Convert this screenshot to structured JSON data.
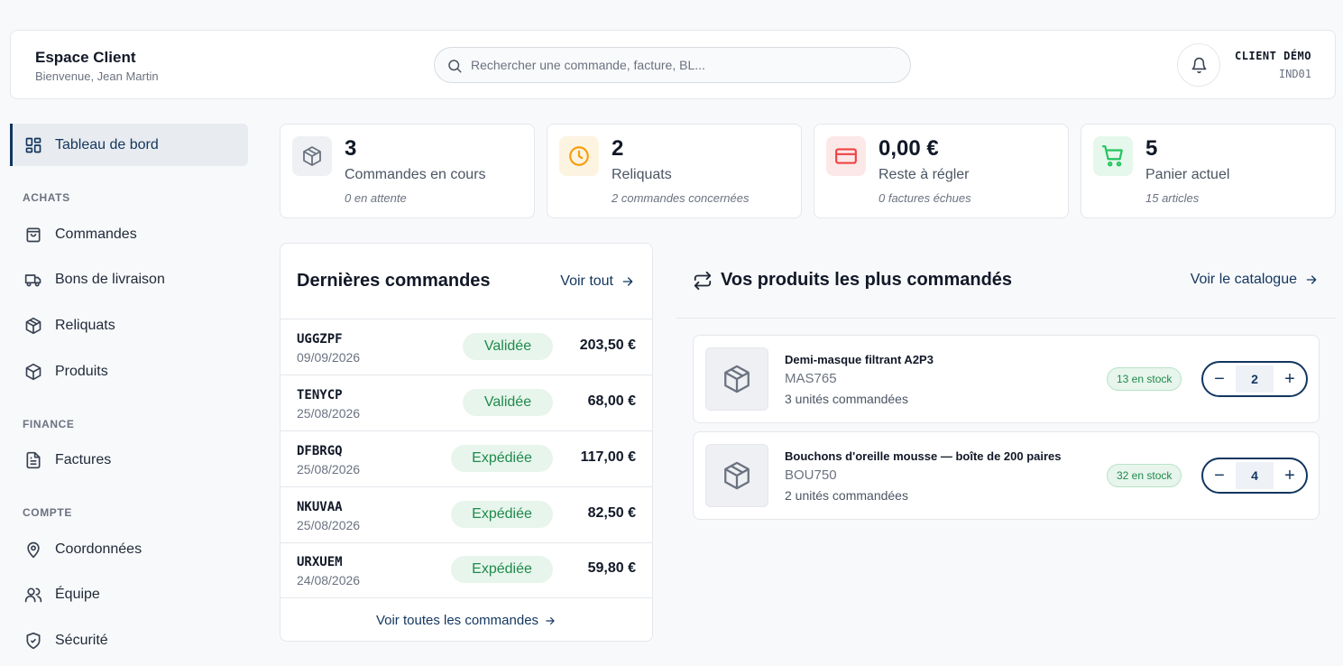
{
  "header": {
    "title": "Espace Client",
    "subtitle": "Bienvenue, Jean Martin",
    "search_placeholder": "Rechercher une commande, facture, BL...",
    "client_name": "CLIENT DÉMO",
    "client_code": "IND01"
  },
  "sidebar": {
    "dashboard": "Tableau de bord",
    "sections": {
      "achats": "ACHATS",
      "finance": "FINANCE",
      "compte": "COMPTE"
    },
    "items": {
      "commandes": "Commandes",
      "bons": "Bons de livraison",
      "reliquats": "Reliquats",
      "produits": "Produits",
      "factures": "Factures",
      "coordonnees": "Coordonnées",
      "equipe": "Équipe",
      "securite": "Sécurité"
    }
  },
  "kpis": [
    {
      "value": "3",
      "label": "Commandes en cours",
      "sub": "0 en attente",
      "icon": "package-icon",
      "color": "#6b7280",
      "bg": "#eef0f3"
    },
    {
      "value": "2",
      "label": "Reliquats",
      "sub": "2 commandes concernées",
      "icon": "clock-icon",
      "color": "#f59e0b",
      "bg": "#fdf3e1"
    },
    {
      "value": "0,00 €",
      "label": "Reste à régler",
      "sub": "0 factures échues",
      "icon": "credit-card-icon",
      "color": "#ef4444",
      "bg": "#fde8e8"
    },
    {
      "value": "5",
      "label": "Panier actuel",
      "sub": "15 articles",
      "icon": "cart-icon",
      "color": "#22c55e",
      "bg": "#e6f7ec"
    }
  ],
  "orders": {
    "title": "Dernières commandes",
    "see_all": "Voir tout",
    "footer": "Voir toutes les commandes",
    "rows": [
      {
        "ref": "UGGZPF",
        "date": "09/09/2026",
        "status": "Validée",
        "amount": "203,50 €"
      },
      {
        "ref": "TENYCP",
        "date": "25/08/2026",
        "status": "Validée",
        "amount": "68,00 €"
      },
      {
        "ref": "DFBRGQ",
        "date": "25/08/2026",
        "status": "Expédiée",
        "amount": "117,00 €"
      },
      {
        "ref": "NKUVAA",
        "date": "25/08/2026",
        "status": "Expédiée",
        "amount": "82,50 €"
      },
      {
        "ref": "URXUEM",
        "date": "24/08/2026",
        "status": "Expédiée",
        "amount": "59,80 €"
      }
    ]
  },
  "products": {
    "title": "Vos produits les plus commandés",
    "catalogue": "Voir le catalogue",
    "items": [
      {
        "name": "Demi-masque filtrant A2P3",
        "ref": "MAS765",
        "ordered": "3 unités commandées",
        "stock": "13 en stock",
        "qty": "2"
      },
      {
        "name": "Bouchons d'oreille mousse — boîte de 200 paires",
        "ref": "BOU750",
        "ordered": "2 unités commandées",
        "stock": "32 en stock",
        "qty": "4"
      }
    ]
  },
  "colors": {
    "accent": "#12365f",
    "success_bg": "#e7f5ec",
    "success_text": "#1f8a4c"
  }
}
